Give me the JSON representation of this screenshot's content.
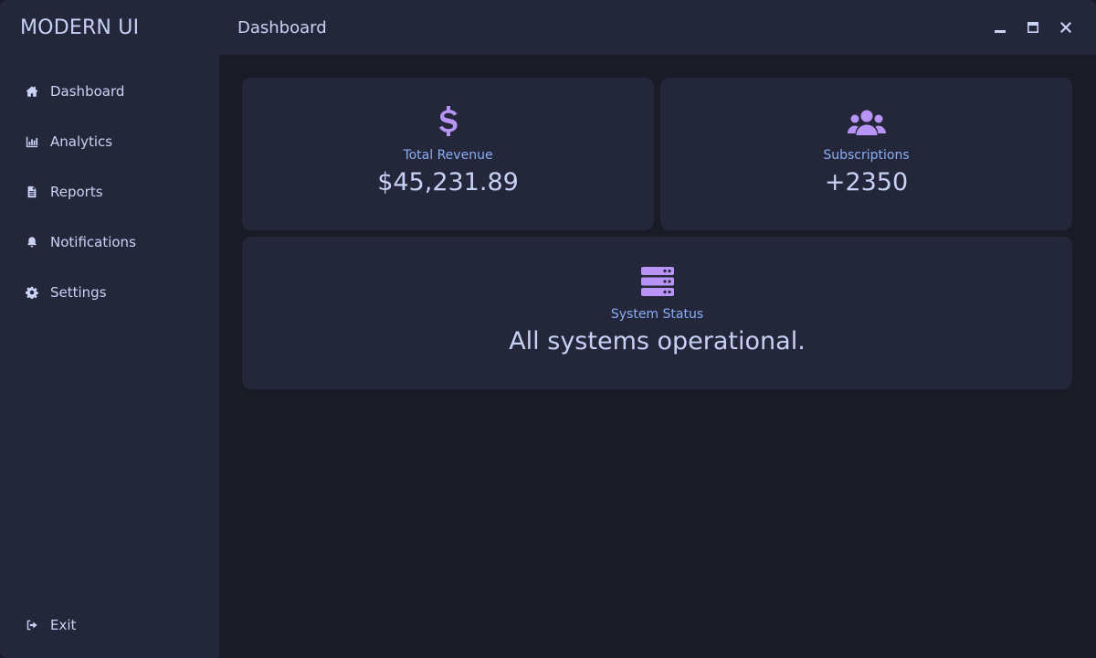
{
  "app": {
    "brand": "MODERN UI"
  },
  "header": {
    "title": "Dashboard"
  },
  "sidebar": {
    "items": [
      {
        "label": "Dashboard",
        "icon": "home-icon"
      },
      {
        "label": "Analytics",
        "icon": "chart-icon"
      },
      {
        "label": "Reports",
        "icon": "file-icon"
      },
      {
        "label": "Notifications",
        "icon": "bell-icon"
      },
      {
        "label": "Settings",
        "icon": "gear-icon"
      }
    ],
    "exit": {
      "label": "Exit",
      "icon": "sign-out-icon"
    }
  },
  "window_controls": [
    "minimize-icon",
    "maximize-icon",
    "close-icon"
  ],
  "cards": {
    "revenue": {
      "label": "Total Revenue",
      "value": "$45,231.89",
      "icon": "dollar-icon"
    },
    "subscriptions": {
      "label": "Subscriptions",
      "value": "+2350",
      "icon": "users-icon"
    },
    "status": {
      "label": "System Status",
      "value": "All systems operational.",
      "icon": "server-icon"
    }
  },
  "colors": {
    "sidebar_bg": "#24273a",
    "main_bg": "#1b1b28",
    "accent": "#b794f6",
    "label": "#8aadf4",
    "text": "#cad3f5"
  }
}
